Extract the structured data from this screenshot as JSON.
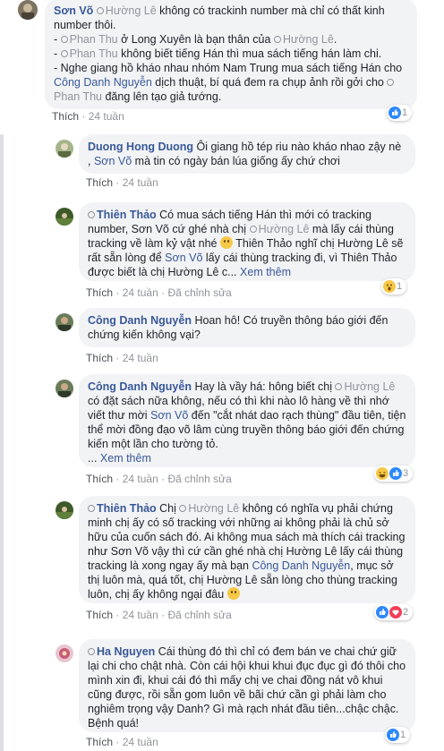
{
  "comments": [
    {
      "name": "Sơn Võ",
      "tag1": "Hường Lê",
      "t1": " không có trackinh number mà chỉ có thất kinh number thôi.",
      "l2a": "- ",
      "tag2": "Phan Thu",
      "l2b": " ở Long Xuyên là bạn thân của ",
      "tag3": "Hường Lê",
      "l2c": ".",
      "l3a": "- ",
      "tag4": "Phan Thu",
      "l3b": " không biết tiếng Hán thì mua sách tiếng hán làm chi.",
      "l4a": "- Nghe giang hồ kháo nhau nhóm Nam Trung mua sách tiếng Hán cho ",
      "link1": "Công Danh Nguyễn",
      "l4b": " dịch thuật, bí quá đem ra chụp ảnh rồi gởi cho ",
      "tag5": "Phan Thu",
      "l4c": " đăng lên tạo giả tướng.",
      "like": "Thích",
      "time": "24 tuần",
      "count": "1"
    },
    {
      "name": "Duong Hong Duong",
      "t1": " Ôi giang hồ tép riu nào kháo nhao zậy nè , ",
      "link1": "Sơn Võ",
      "t2": " mà tin có ngày bán lúa giống ấy chứ chơi",
      "like": "Thích",
      "time": "24 tuần"
    },
    {
      "name": "Thiên Thảo",
      "t1": " Có mua sách tiếng Hán thì mới có tracking number, Sơn Võ cứ ghé nhà chị ",
      "tag1": "Hường Lê",
      "t2": " mà lấy cái thùng tracking về làm kỷ vật nhé ",
      "t3": " Thiên Thảo nghĩ chị Hường Lê sẽ rất sẵn lòng để ",
      "link1": "Sơn Võ",
      "t4": " lấy cái thùng tracking đi, vì Thiên Thảo được biết là chị Hường Lê c...",
      "more": "Xem thêm",
      "like": "Thích",
      "time": "24 tuần",
      "edited": "Đã chỉnh sửa",
      "count": "1"
    },
    {
      "name": "Công Danh Nguyễn",
      "t1": " Hoan hô! Có truyền thông báo giới đến chứng kiến không vại?",
      "like": "Thích",
      "time": "24 tuần"
    },
    {
      "name": "Công Danh Nguyễn",
      "t1": " Hay là vầy há: hông biết chị ",
      "tag1": "Hường Lê",
      "t2": " có đặt sách nữa không, nếu có thì khi nào lô hàng về thì nhớ viết thư mời ",
      "link1": "Sơn Võ",
      "t3": " đến \"cắt nhát dao rạch thùng\" đầu tiên, tiện thể mời đồng đạo võ lâm cùng truyền thông báo giới đến chứng kiến một lần cho tường tỏ.",
      "dots": "... ",
      "more": "Xem thêm",
      "like": "Thích",
      "time": "24 tuần",
      "edited": "Đã chỉnh sửa",
      "count": "3"
    },
    {
      "name": "Thiên Thảo",
      "t0": " Chị ",
      "tag1": "Hường Lê",
      "t1": " không có nghĩa vụ phải chứng minh chị ấy có số tracking với những ai không phải là chủ sở hữu của cuốn sách đó. Ai không mua sách mà thích cái tracking như Sơn Võ vậy thì cứ cần ghé nhà chị Hường Lê lấy cái thùng tracking là xong ngay ấy mà bạn ",
      "link1": "Công Danh Nguyễn",
      "t2": ", mục sở thị luôn mà, quá tốt, chị Hường Lê sẵn lòng cho thùng tracking luôn, chị ấy không ngại đâu ",
      "like": "Thích",
      "time": "24 tuần",
      "edited": "Đã chỉnh sửa",
      "count": "2"
    },
    {
      "name": "Ha Nguyen",
      "t1": " Cái thùng đó thì chỉ có đem bán ve chai chứ giữ lại chi cho chật nhà. Còn cái hội khui khui đục đục gì đó thôi cho mình xin đi, khui cái đó thì mấy chị ve chai đồng nát vô khui cũng được, rồi sẵn gom luôn về bãi chứ cần gì phải làm cho nghiêm trọng vậy Danh? Gì mà rạch nhát đầu tiên...chậc chậc. Bệnh quá!",
      "like": "Thích",
      "time": "24 tuần",
      "count": "1"
    }
  ],
  "sep": "·",
  "colors": {
    "link": "#385898",
    "muted": "#90949c",
    "bubble": "#f2f3f5",
    "like_blue": "#2d88ff",
    "love_red": "#f33e58",
    "reaction_yellow": "#f7c845"
  },
  "icons": [
    "like-reaction-icon",
    "love-reaction-icon",
    "wow-reaction-icon",
    "haha-reaction-icon",
    "tag-icon",
    "smile-emoji-icon"
  ]
}
